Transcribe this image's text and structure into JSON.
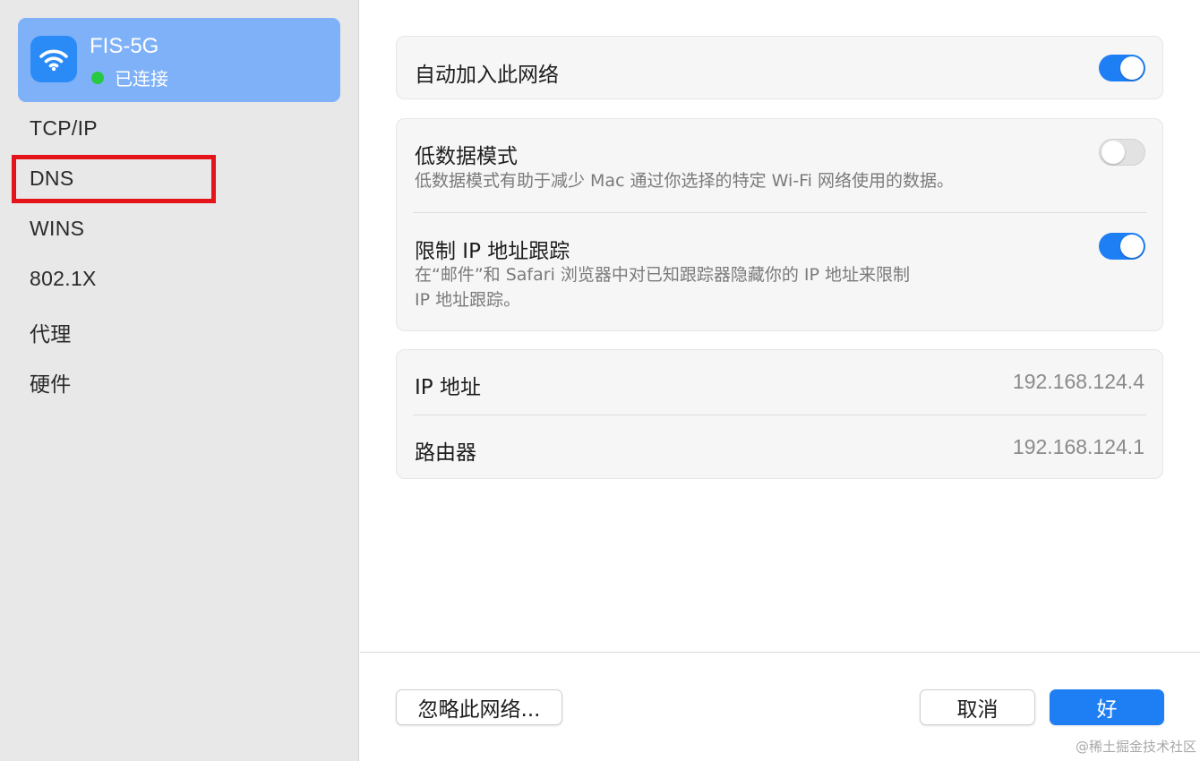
{
  "sidebar": {
    "network": {
      "name": "FIS-5G",
      "status": "已连接",
      "status_color": "#28c940",
      "icon": "wifi-icon"
    },
    "items": [
      {
        "label": "TCP/IP"
      },
      {
        "label": "DNS",
        "highlighted": true
      },
      {
        "label": "WINS"
      },
      {
        "label": "802.1X"
      },
      {
        "label": "代理"
      },
      {
        "label": "硬件"
      }
    ]
  },
  "main": {
    "auto_join": {
      "label": "自动加入此网络",
      "enabled": true
    },
    "low_data": {
      "label": "低数据模式",
      "description": "低数据模式有助于减少 Mac 通过你选择的特定 Wi-Fi 网络使用的数据。",
      "enabled": false
    },
    "limit_ip": {
      "label": "限制 IP 地址跟踪",
      "description_line1": "在“邮件”和 Safari 浏览器中对已知跟踪器隐藏你的 IP 地址来限制",
      "description_line2": "IP 地址跟踪。",
      "enabled": true
    },
    "ip_address": {
      "label": "IP 地址",
      "value": "192.168.124.4"
    },
    "router": {
      "label": "路由器",
      "value": "192.168.124.1"
    }
  },
  "footer": {
    "forget_label": "忽略此网络...",
    "cancel_label": "取消",
    "ok_label": "好"
  },
  "watermark": "@稀土掘金技术社区",
  "colors": {
    "accent": "#1e7ff4",
    "selected_card": "#7fb1f9",
    "highlight_box": "#e5141b"
  }
}
